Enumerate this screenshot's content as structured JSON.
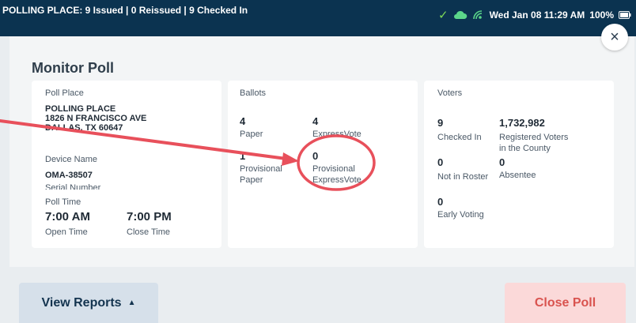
{
  "statusbar": {
    "polling_summary": "POLLING PLACE: 9 Issued | 0 Reissued | 9 Checked In",
    "datetime": "Wed Jan 08  11:29 AM",
    "battery": "100%"
  },
  "dialog": {
    "title": "Monitor Poll",
    "close_symbol": "×"
  },
  "poll_card": {
    "poll_place_label": "Poll Place",
    "poll_place_name": "POLLING PLACE",
    "address_line1": "1826  N FRANCISCO AVE",
    "address_line2": "DALLAS, TX 60647",
    "device_name_label": "Device Name",
    "device_name": "OMA-38507",
    "serial_number_label": "Serial Number",
    "poll_time_label": "Poll Time",
    "open_time": "7:00 AM",
    "open_time_label": "Open Time",
    "close_time": "7:00 PM",
    "close_time_label": "Close Time"
  },
  "ballots_card": {
    "title": "Ballots",
    "paper_count": "4",
    "paper_label": "Paper",
    "expressvote_count": "4",
    "expressvote_label": "ExpressVote",
    "prov_paper_count": "1",
    "prov_paper_label1": "Provisional",
    "prov_paper_label2": "Paper",
    "prov_express_count": "0",
    "prov_express_label1": "Provisional",
    "prov_express_label2": "ExpressVote"
  },
  "voters_card": {
    "title": "Voters",
    "checked_in_count": "9",
    "checked_in_label": "Checked In",
    "registered_count": "1,732,982",
    "registered_label1": "Registered Voters",
    "registered_label2": "in the County",
    "not_in_roster_count": "0",
    "not_in_roster_label": "Not in Roster",
    "absentee_count": "0",
    "absentee_label": "Absentee",
    "early_voting_count": "0",
    "early_voting_label": "Early Voting"
  },
  "buttons": {
    "view_reports": "View Reports",
    "view_reports_arrow": "▲",
    "close_poll": "Close Poll"
  },
  "colors": {
    "header_bg": "#0b3350",
    "annotation": "#e8505b",
    "close_poll_text": "#d9534f"
  }
}
